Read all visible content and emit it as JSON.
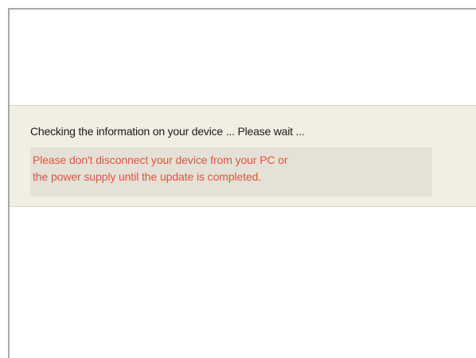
{
  "status": {
    "message": "Checking the information on your device ... Please wait ..."
  },
  "warning": {
    "line1": "Please don't disconnect your device from your PC or",
    "line2": "the power supply until the update is completed."
  },
  "colors": {
    "warning_text": "#e0533c",
    "band_background": "#f1efe2",
    "warning_background": "#e6e1d7"
  }
}
